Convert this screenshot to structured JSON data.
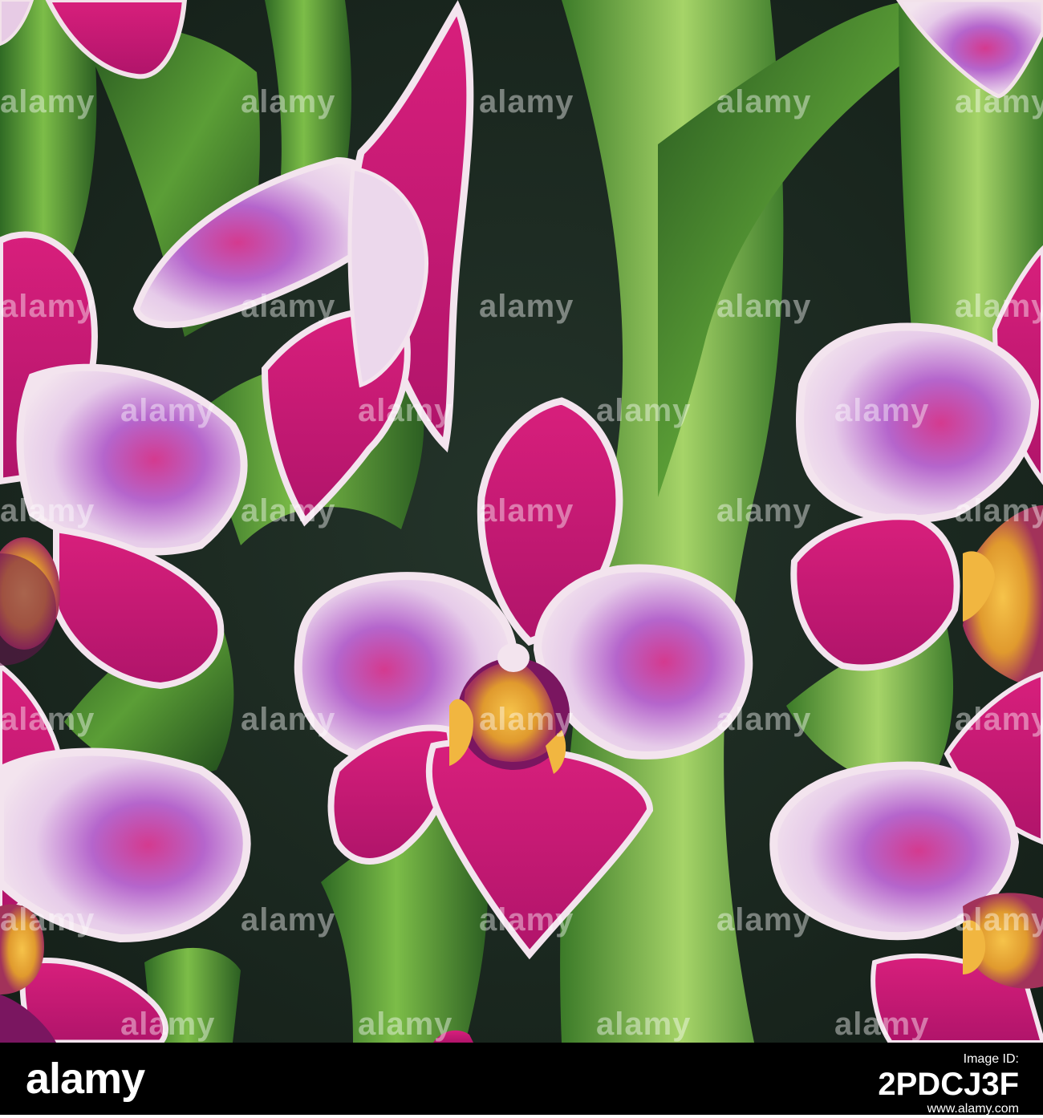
{
  "watermark": {
    "text": "alamy"
  },
  "footer": {
    "logo": "alamy",
    "image_id_label": "Image ID:",
    "image_id": "2PDCJ3F",
    "url": "www.alamy.com"
  },
  "colors": {
    "background": "#1d2b22",
    "leaf": "#4f9a34",
    "petal_magenta": "#c81a78",
    "petal_light": "#ead3ea",
    "lip": "#a0166a",
    "column_yellow": "#f1b640",
    "footer_bg": "#000000"
  }
}
